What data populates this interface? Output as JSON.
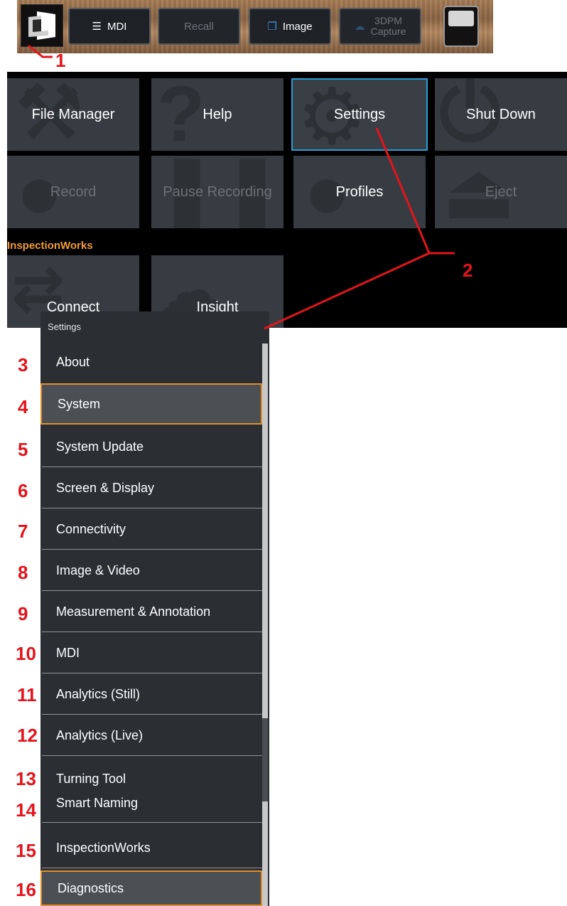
{
  "toolbar": {
    "mdi_label": "MDI",
    "recall_label": "Recall",
    "image_label": "Image",
    "capture_line1": "3DPM",
    "capture_line2": "Capture"
  },
  "main_menu": {
    "tiles": [
      {
        "label": "File Manager",
        "state": "enabled"
      },
      {
        "label": "Help",
        "state": "enabled"
      },
      {
        "label": "Settings",
        "state": "selected"
      },
      {
        "label": "Shut Down",
        "state": "enabled"
      },
      {
        "label": "Record",
        "state": "disabled"
      },
      {
        "label": "Pause Recording",
        "state": "disabled"
      },
      {
        "label": "Profiles",
        "state": "enabled"
      },
      {
        "label": "Eject",
        "state": "disabled"
      }
    ],
    "inspectionworks": {
      "heading": "InspectionWorks",
      "tiles": [
        {
          "label": "Connect"
        },
        {
          "label": "Insight"
        }
      ]
    }
  },
  "settings_menu": {
    "title": "Settings",
    "items": [
      {
        "label": "About"
      },
      {
        "label": "System",
        "highlighted": true
      },
      {
        "label": "System Update"
      },
      {
        "label": "Screen & Display"
      },
      {
        "label": "Connectivity"
      },
      {
        "label": "Image & Video"
      },
      {
        "label": "Measurement & Annotation"
      },
      {
        "label": "MDI"
      },
      {
        "label": "Analytics (Still)"
      },
      {
        "label": "Analytics (Live)"
      },
      {
        "label": "Turning Tool"
      },
      {
        "label": "Smart Naming"
      },
      {
        "label": "InspectionWorks"
      },
      {
        "label": "Diagnostics",
        "highlighted": true
      }
    ]
  },
  "callouts": [
    "1",
    "2",
    "3",
    "4",
    "5",
    "6",
    "7",
    "8",
    "9",
    "10",
    "11",
    "12",
    "13",
    "14",
    "15",
    "16"
  ],
  "colors": {
    "callout_red": "#e3141b",
    "selection_blue": "#2b9cd8",
    "highlight_orange": "#e08e2b",
    "section_orange": "#f29b36"
  }
}
